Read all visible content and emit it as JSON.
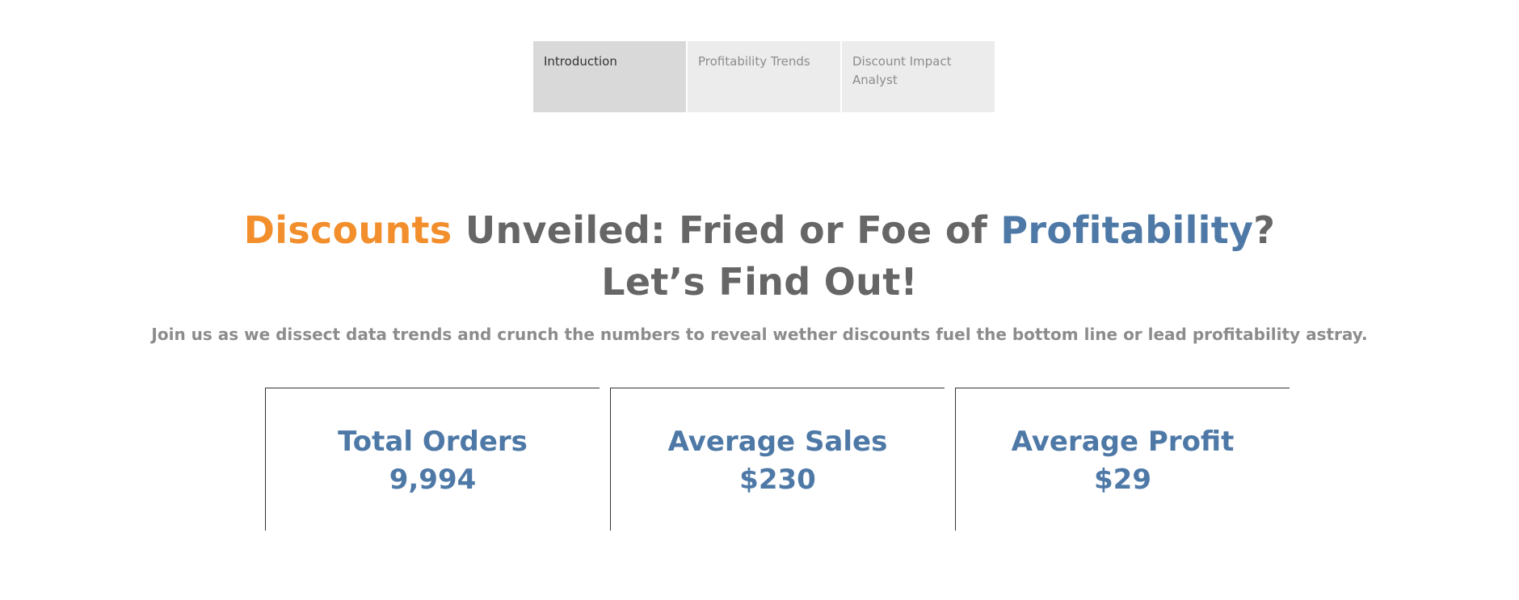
{
  "tabs": [
    {
      "label": "Introduction",
      "active": true
    },
    {
      "label": "Profitability Trends",
      "active": false
    },
    {
      "label": "Discount Impact Analyst",
      "active": false
    }
  ],
  "headline": {
    "word_discounts": "Discounts",
    "middle": " Unveiled: Fried or Foe of ",
    "word_profitability": "Profitability",
    "end": "?",
    "line2": "Let’s Find Out!"
  },
  "subtitle": "Join us as we dissect data trends and crunch the numbers to reveal wether discounts fuel the bottom line or lead profitability astray.",
  "kpis": [
    {
      "label": "Total Orders",
      "value": "9,994"
    },
    {
      "label": "Average Sales",
      "value": "$230"
    },
    {
      "label": "Average Profit",
      "value": "$29"
    }
  ],
  "colors": {
    "accent_orange": "#f28e2b",
    "accent_blue": "#4e79a7",
    "text_gray": "#666666",
    "subtitle_gray": "#8c8c8c",
    "tab_active_bg": "#d9d9d9",
    "tab_inactive_bg": "#ececec"
  }
}
